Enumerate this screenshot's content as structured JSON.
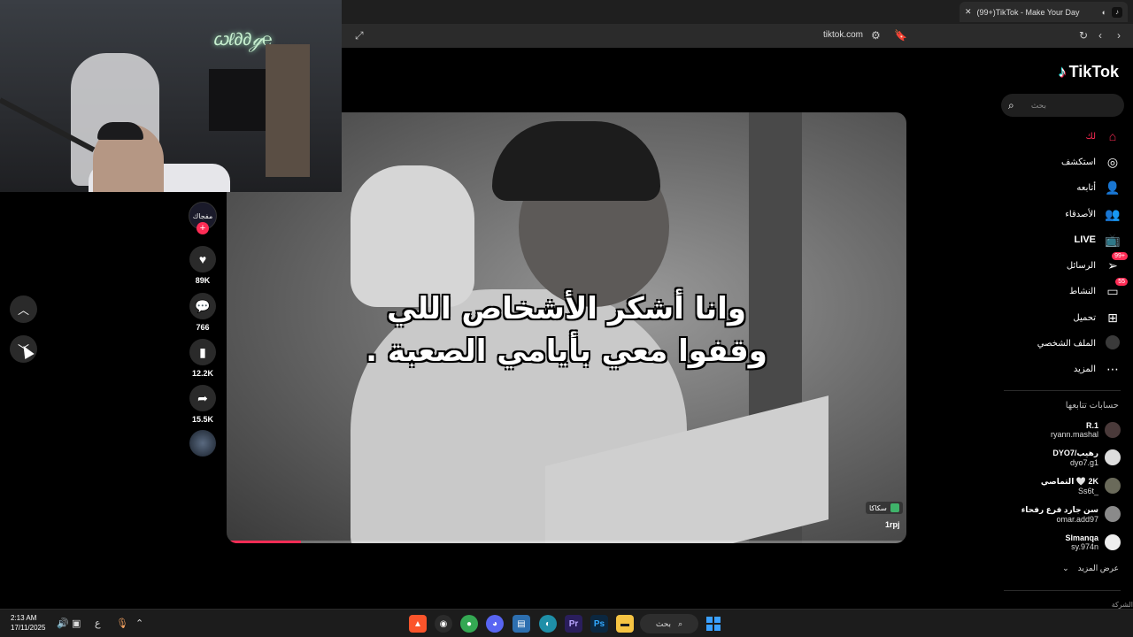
{
  "browser": {
    "tab_title": "(99+)TikTok - Make Your Day",
    "url": "tiktok.com",
    "new_tab": "+",
    "close": "✕"
  },
  "video": {
    "caption_line1": "وانا أشكر الأشخاص اللي",
    "caption_line2": "وقفوا معي بأيامي الصعبة .",
    "watermark_label": "سكاكا",
    "watermark_user": "1rpj",
    "progress": 0.11
  },
  "actions": {
    "creator_label": "مفجاك",
    "like_count": "89K",
    "comment_count": "766",
    "bookmark_count": "12.2K",
    "share_count": "15.5K"
  },
  "sidebar": {
    "brand": "TikTok",
    "search_placeholder": "بحث",
    "nav": [
      {
        "label": "لك",
        "icon": "home-icon",
        "active": true
      },
      {
        "label": "استكشف",
        "icon": "compass-icon"
      },
      {
        "label": "أتابعه",
        "icon": "following-icon"
      },
      {
        "label": "الأصدقاء",
        "icon": "friends-icon"
      },
      {
        "label": "LIVE",
        "icon": "live-icon"
      },
      {
        "label": "الرسائل",
        "icon": "messages-icon",
        "badge": "99+"
      },
      {
        "label": "النشاط",
        "icon": "activity-icon",
        "badge": "55"
      },
      {
        "label": "تحميل",
        "icon": "upload-icon"
      },
      {
        "label": "الملف الشخصي",
        "icon": "profile-icon"
      },
      {
        "label": "المزيد",
        "icon": "more-icon"
      }
    ],
    "following_title": "حسابات تتابعها",
    "accounts": [
      {
        "name": "R.1",
        "handle": "ryann.mashal"
      },
      {
        "name": "رهيب/DYO7",
        "handle": "dyo7.g1"
      },
      {
        "name": "2K 🤍 التماصي",
        "handle": "_Ss6t"
      },
      {
        "name": "سن جارد فرع رفحاء",
        "handle": "omar.add97"
      },
      {
        "name": "Slmanqa",
        "handle": "sy.974n"
      }
    ],
    "see_more": "عرض المزيد",
    "company": "الشركة"
  },
  "taskbar": {
    "time": "2:13 AM",
    "date": "17/11/2025",
    "lang": "ع",
    "search_label": "بحث"
  },
  "colors": {
    "accent": "#fe2c55",
    "background": "#000000",
    "surface": "#2a2a2a"
  }
}
